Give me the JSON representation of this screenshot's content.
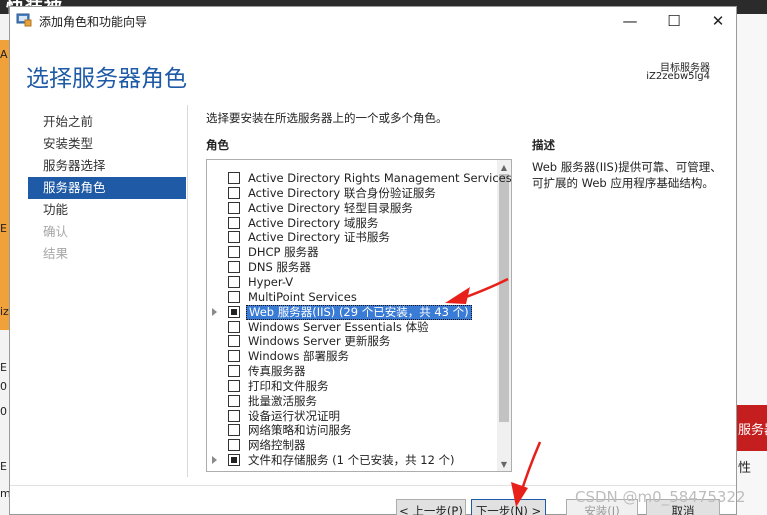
{
  "background": {
    "title_fragment": "快装被",
    "left_fragments": [
      "A",
      "E",
      "iz",
      "E",
      "0",
      "0",
      "E",
      "m"
    ],
    "right_red_text": "服务器",
    "right_text": "性"
  },
  "window": {
    "title": "添加角色和功能向导",
    "minimize_glyph": "—",
    "maximize_glyph": "☐",
    "close_glyph": "✕"
  },
  "header": {
    "title": "选择服务器角色",
    "destination_label": "目标服务器",
    "destination_name": "iZ2zebw5lg4"
  },
  "nav": {
    "items": [
      {
        "label": "开始之前",
        "state": "normal"
      },
      {
        "label": "安装类型",
        "state": "normal"
      },
      {
        "label": "服务器选择",
        "state": "normal"
      },
      {
        "label": "服务器角色",
        "state": "active"
      },
      {
        "label": "功能",
        "state": "normal"
      },
      {
        "label": "确认",
        "state": "disabled"
      },
      {
        "label": "结果",
        "state": "disabled"
      }
    ]
  },
  "main": {
    "intro": "选择要安装在所选服务器上的一个或多个角色。",
    "roles_header": "角色",
    "description_header": "描述",
    "description_text": "Web 服务器(IIS)提供可靠、可管理、可扩展的 Web 应用程序基础结构。"
  },
  "roles": [
    {
      "label": "Active Directory Rights Management Services",
      "checked": "none",
      "expandable": false,
      "selected": false
    },
    {
      "label": "Active Directory 联合身份验证服务",
      "checked": "none",
      "expandable": false,
      "selected": false
    },
    {
      "label": "Active Directory 轻型目录服务",
      "checked": "none",
      "expandable": false,
      "selected": false
    },
    {
      "label": "Active Directory 域服务",
      "checked": "none",
      "expandable": false,
      "selected": false
    },
    {
      "label": "Active Directory 证书服务",
      "checked": "none",
      "expandable": false,
      "selected": false
    },
    {
      "label": "DHCP 服务器",
      "checked": "none",
      "expandable": false,
      "selected": false
    },
    {
      "label": "DNS 服务器",
      "checked": "none",
      "expandable": false,
      "selected": false
    },
    {
      "label": "Hyper-V",
      "checked": "none",
      "expandable": false,
      "selected": false
    },
    {
      "label": "MultiPoint Services",
      "checked": "none",
      "expandable": false,
      "selected": false
    },
    {
      "label": "Web 服务器(IIS) (29 个已安装，共 43 个)",
      "checked": "partial",
      "expandable": true,
      "selected": true
    },
    {
      "label": "Windows Server Essentials 体验",
      "checked": "none",
      "expandable": false,
      "selected": false
    },
    {
      "label": "Windows Server 更新服务",
      "checked": "none",
      "expandable": false,
      "selected": false
    },
    {
      "label": "Windows 部署服务",
      "checked": "none",
      "expandable": false,
      "selected": false
    },
    {
      "label": "传真服务器",
      "checked": "none",
      "expandable": false,
      "selected": false
    },
    {
      "label": "打印和文件服务",
      "checked": "none",
      "expandable": false,
      "selected": false
    },
    {
      "label": "批量激活服务",
      "checked": "none",
      "expandable": false,
      "selected": false
    },
    {
      "label": "设备运行状况证明",
      "checked": "none",
      "expandable": false,
      "selected": false
    },
    {
      "label": "网络策略和访问服务",
      "checked": "none",
      "expandable": false,
      "selected": false
    },
    {
      "label": "网络控制器",
      "checked": "none",
      "expandable": false,
      "selected": false
    },
    {
      "label": "文件和存储服务 (1 个已安装，共 12 个)",
      "checked": "partial",
      "expandable": true,
      "selected": false
    }
  ],
  "scrollbar": {
    "up_glyph": "▲",
    "down_glyph": "▼"
  },
  "buttons": {
    "previous": "< 上一步(P)",
    "next": "下一步(N) >",
    "install": "安装(I)",
    "cancel": "取消"
  },
  "watermark": "CSDN @m0_58475322",
  "colors": {
    "accent": "#1e5aa6",
    "selection": "#3a7bd5",
    "annotation_arrow": "#e8201a"
  }
}
